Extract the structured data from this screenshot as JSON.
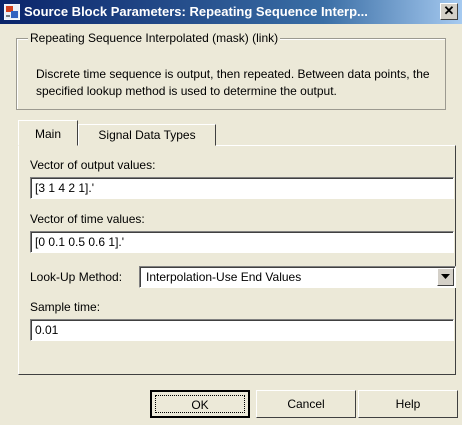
{
  "window": {
    "title": "Source Block Parameters: Repeating Sequence Interp...",
    "close_glyph": "✕",
    "icon": "simulink-block-icon"
  },
  "mask": {
    "group_label": "Repeating Sequence Interpolated (mask) (link)",
    "description": "Discrete time sequence is output, then repeated.  Between data points, the specified lookup method is used to determine the output."
  },
  "tabs": [
    {
      "label": "Main",
      "active": true
    },
    {
      "label": "Signal Data Types",
      "active": false
    }
  ],
  "params": {
    "output_values_label": "Vector of output values:",
    "output_values": "[3 1 4 2 1].'",
    "time_values_label": "Vector of time values:",
    "time_values": "[0 0.1 0.5 0.6 1].'",
    "lookup_label": "Look-Up Method:",
    "lookup_value": "Interpolation-Use End Values",
    "sample_time_label": "Sample time:",
    "sample_time": "0.01"
  },
  "buttons": {
    "ok": "OK",
    "cancel": "Cancel",
    "help": "Help"
  }
}
